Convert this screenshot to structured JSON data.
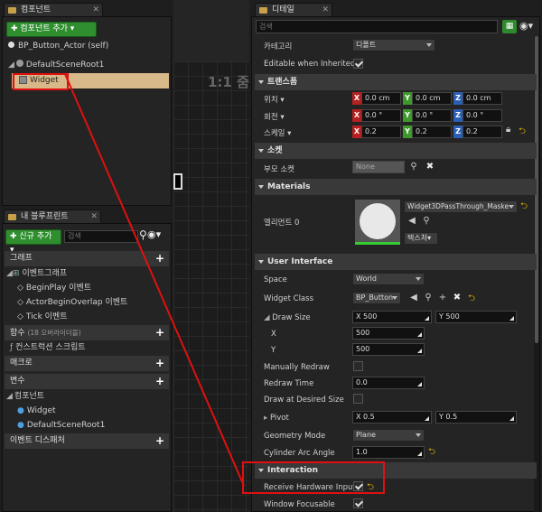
{
  "components_tab": {
    "label": "컴포넌트"
  },
  "components": {
    "add_button": "✚ 컴포넌트 추가 ▾",
    "self_item": "BP_Button_Actor (self)",
    "root_item": "DefaultSceneRoot1",
    "widget_item": "Widget"
  },
  "viewport": {
    "zoom_label": "1:1 줌"
  },
  "blueprint_tab": {
    "label": "내 블루프린트"
  },
  "blueprint": {
    "add_new": "✚ 신규 추가 ▾",
    "search_placeholder": "검색",
    "graph_header": "그래프",
    "event_graph": "이벤트그래프",
    "events": [
      "BeginPlay 이벤트",
      "ActorBeginOverlap 이벤트",
      "Tick 이벤트"
    ],
    "functions_header": "함수",
    "functions_hint": "(18 오버라이더블)",
    "construction_script": "컨스트럭션 스크립트",
    "macros_header": "매크로",
    "variables_header": "변수",
    "components_sub": "컴포넌트",
    "var_items": [
      "Widget",
      "DefaultSceneRoot1"
    ],
    "dispatchers_header": "이벤트 디스패처"
  },
  "details_tab": {
    "label": "디테일"
  },
  "details": {
    "search_placeholder": "검색",
    "category_label": "카테고리",
    "category_value": "디폴트",
    "editable_label": "Editable when Inherited",
    "transform_header": "트랜스폼",
    "location_label": "위치 ▾",
    "location": [
      "0.0 cm",
      "0.0 cm",
      "0.0 cm"
    ],
    "rotation_label": "회전 ▾",
    "rotation": [
      "0.0 °",
      "0.0 °",
      "0.0 °"
    ],
    "scale_label": "스케일 ▾",
    "scale": [
      "0.2",
      "0.2",
      "0.2"
    ],
    "axes": [
      "X",
      "Y",
      "Z"
    ],
    "socket_header": "소켓",
    "parent_socket_label": "부모 소켓",
    "parent_socket_value": "None",
    "materials_header": "Materials",
    "element_label": "엘리먼트 0",
    "material_value": "Widget3DPassThrough_Maske",
    "texture_button": "텍스처▾",
    "ui_header": "User Interface",
    "space_label": "Space",
    "space_value": "World",
    "widget_class_label": "Widget Class",
    "widget_class_value": "BP_Button",
    "draw_size_label": "Draw Size",
    "draw_size": [
      "X  500",
      "Y  500"
    ],
    "draw_x_label": "X",
    "draw_x": "500",
    "draw_y_label": "Y",
    "draw_y": "500",
    "manual_redraw_label": "Manually Redraw",
    "redraw_time_label": "Redraw Time",
    "redraw_time": "0.0",
    "draw_desired_label": "Draw at Desired Size",
    "pivot_label": "Pivot",
    "pivot": [
      "X  0.5",
      "Y  0.5"
    ],
    "geometry_label": "Geometry Mode",
    "geometry_value": "Plane",
    "cyl_label": "Cylinder Arc Angle",
    "cyl_value": "1.0",
    "interaction_header": "Interaction",
    "receive_input_label": "Receive Hardware Input",
    "focusable_label": "Window Focusable"
  },
  "colors": {
    "highlight_red": "#e01010",
    "selected_row": "#d9b98a",
    "axis_x": "#b52020",
    "axis_y": "#3d9a2a",
    "axis_z": "#2a5fb5"
  }
}
